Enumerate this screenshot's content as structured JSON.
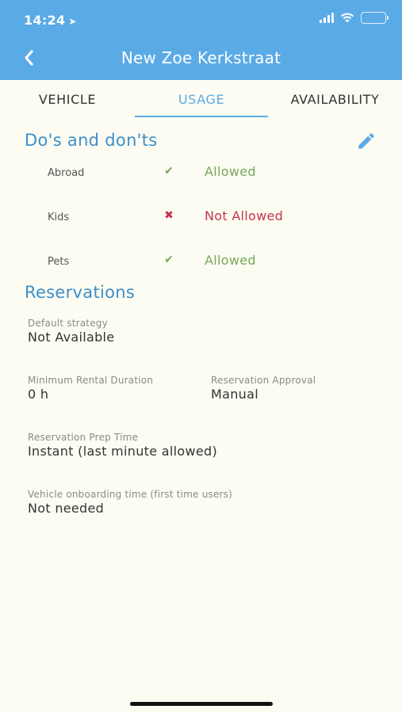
{
  "status_bar": {
    "time": "14:24"
  },
  "header": {
    "title": "New Zoe Kerkstraat"
  },
  "tabs": [
    {
      "label": "VEHICLE"
    },
    {
      "label": "USAGE"
    },
    {
      "label": "AVAILABILITY"
    }
  ],
  "dos_donts": {
    "title": "Do's and don'ts",
    "rules": [
      {
        "label": "Abroad",
        "icon": "check-icon",
        "status": "Allowed"
      },
      {
        "label": "Kids",
        "icon": "cross-icon",
        "status": "Not Allowed"
      },
      {
        "label": "Pets",
        "icon": "check-icon",
        "status": "Allowed"
      }
    ]
  },
  "reservations": {
    "title": "Reservations",
    "default_strategy": {
      "label": "Default strategy",
      "value": "Not Available"
    },
    "min_rental": {
      "label": "Minimum Rental Duration",
      "value": "0 h"
    },
    "approval": {
      "label": "Reservation Approval",
      "value": "Manual"
    },
    "prep_time": {
      "label": "Reservation Prep Time",
      "value": "Instant (last minute allowed)"
    },
    "onboarding": {
      "label": "Vehicle onboarding time (first time users)",
      "value": "Not needed"
    }
  },
  "colors": {
    "accent": "#5aaae6",
    "allowed": "#77a85a",
    "not_allowed": "#c43550",
    "background": "#fcfcf2"
  }
}
